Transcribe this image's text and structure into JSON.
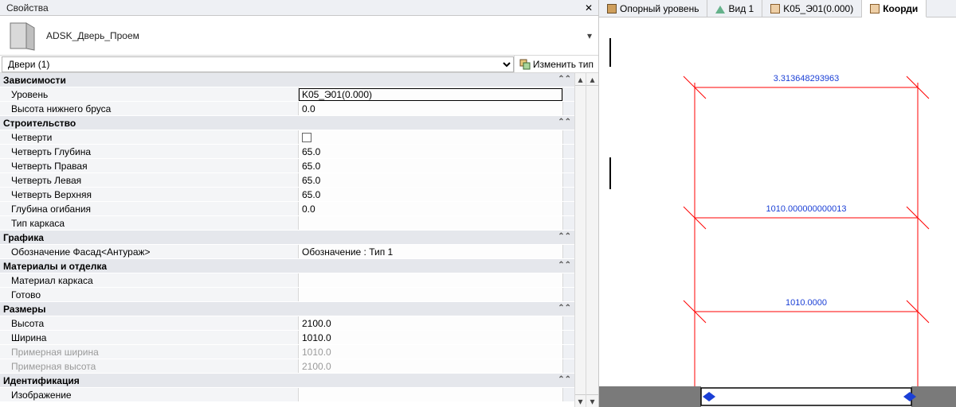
{
  "panel": {
    "title": "Свойства",
    "edit_type": "Изменить тип"
  },
  "type": {
    "name": "ADSK_Дверь_Проем"
  },
  "selector": {
    "value": "Двери (1)"
  },
  "groups": [
    {
      "name": "Зависимости",
      "rows": [
        {
          "label": "Уровень",
          "value": "K05_Э01(0.000)",
          "boxed": true
        },
        {
          "label": "Высота нижнего бруса",
          "value": "0.0"
        }
      ]
    },
    {
      "name": "Строительство",
      "rows": [
        {
          "label": "Четверти",
          "value": "",
          "checkbox": true
        },
        {
          "label": "Четверть Глубина",
          "value": "65.0"
        },
        {
          "label": "Четверть Правая",
          "value": "65.0"
        },
        {
          "label": "Четверть Левая",
          "value": "65.0"
        },
        {
          "label": "Четверть Верхняя",
          "value": "65.0"
        },
        {
          "label": "Глубина огибания",
          "value": "0.0"
        },
        {
          "label": "Тип каркаса",
          "value": ""
        }
      ]
    },
    {
      "name": "Графика",
      "rows": [
        {
          "label": "Обозначение Фасад<Антураж>",
          "value": "Обозначение : Тип 1"
        }
      ]
    },
    {
      "name": "Материалы и отделка",
      "rows": [
        {
          "label": "Материал каркаса",
          "value": ""
        },
        {
          "label": "Готово",
          "value": ""
        }
      ]
    },
    {
      "name": "Размеры",
      "rows": [
        {
          "label": "Высота",
          "value": "2100.0"
        },
        {
          "label": "Ширина",
          "value": "1010.0"
        },
        {
          "label": "Примерная ширина",
          "value": "1010.0",
          "readonly": true
        },
        {
          "label": "Примерная высота",
          "value": "2100.0",
          "readonly": true
        }
      ]
    },
    {
      "name": "Идентификация",
      "rows": [
        {
          "label": "Изображение",
          "value": ""
        }
      ]
    }
  ],
  "tabs": [
    {
      "label": "Опорный уровень",
      "icon": "plan"
    },
    {
      "label": "Вид 1",
      "icon": "3d"
    },
    {
      "label": "K05_Э01(0.000)",
      "icon": "sheet"
    },
    {
      "label": "Коорди",
      "icon": "sheet",
      "active": true
    }
  ],
  "dims": {
    "d1": "3.313648293963",
    "d2": "1010.000000000013",
    "d3": "1010.0000"
  }
}
